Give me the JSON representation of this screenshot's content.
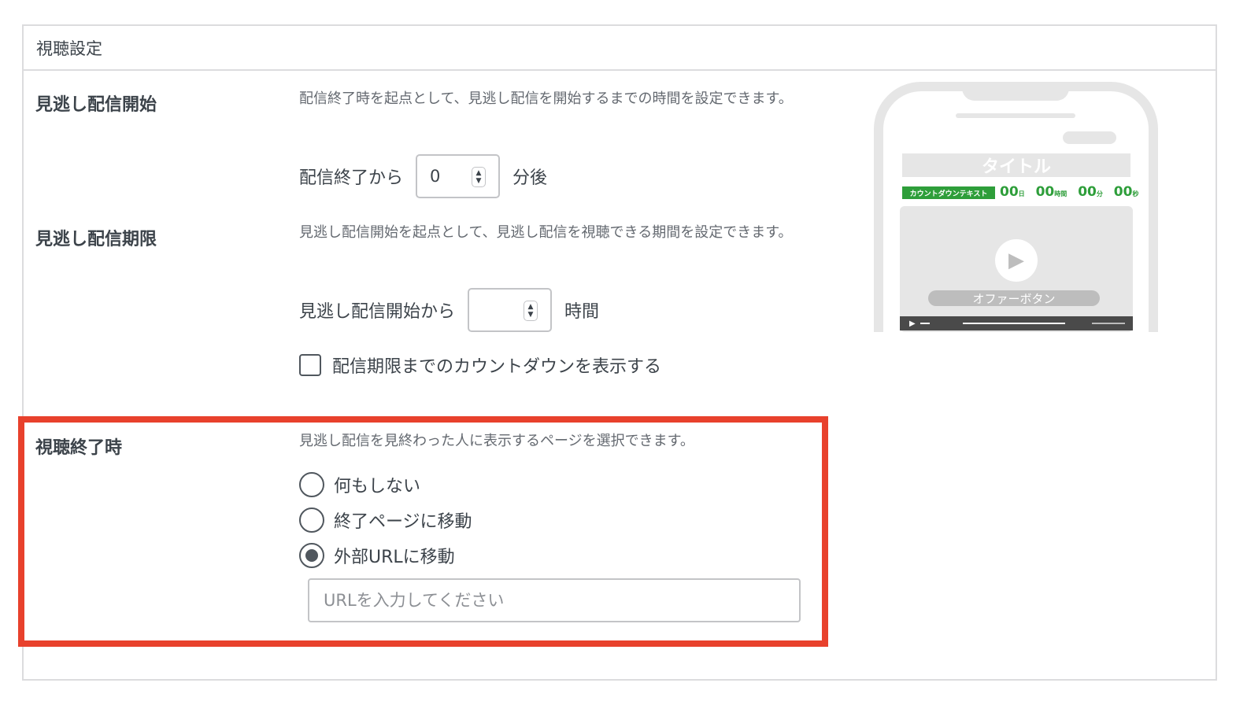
{
  "panel": {
    "title": "視聴設定"
  },
  "section1": {
    "label": "見逃し配信開始",
    "description": "配信終了時を起点として、見逃し配信を開始するまでの時間を設定できます。",
    "prefix": "配信終了から",
    "value": "0",
    "suffix": "分後"
  },
  "section2": {
    "label": "見逃し配信期限",
    "description": "見逃し配信開始を起点として、見逃し配信を視聴できる期間を設定できます。",
    "prefix": "見逃し配信開始から",
    "value": "",
    "suffix": "時間",
    "checkbox_label": "配信期限までのカウントダウンを表示する",
    "checkbox_checked": false
  },
  "section3": {
    "label": "視聴終了時",
    "description": "見逃し配信を見終わった人に表示するページを選択できます。",
    "options": [
      {
        "label": "何もしない",
        "checked": false
      },
      {
        "label": "終了ページに移動",
        "checked": false
      },
      {
        "label": "外部URLに移動",
        "checked": true
      }
    ],
    "url_placeholder": "URLを入力してください"
  },
  "preview": {
    "title": "タイトル",
    "countdown_label": "カウントダウンテキスト",
    "countdown": [
      {
        "value": "00",
        "unit": "日"
      },
      {
        "value": "00",
        "unit": "時間"
      },
      {
        "value": "00",
        "unit": "分"
      },
      {
        "value": "00",
        "unit": "秒"
      }
    ],
    "offer_button": "オファーボタン",
    "play_icon": "play-icon",
    "accent_color": "#2e9e3a"
  },
  "colors": {
    "highlight": "#e8412c"
  }
}
